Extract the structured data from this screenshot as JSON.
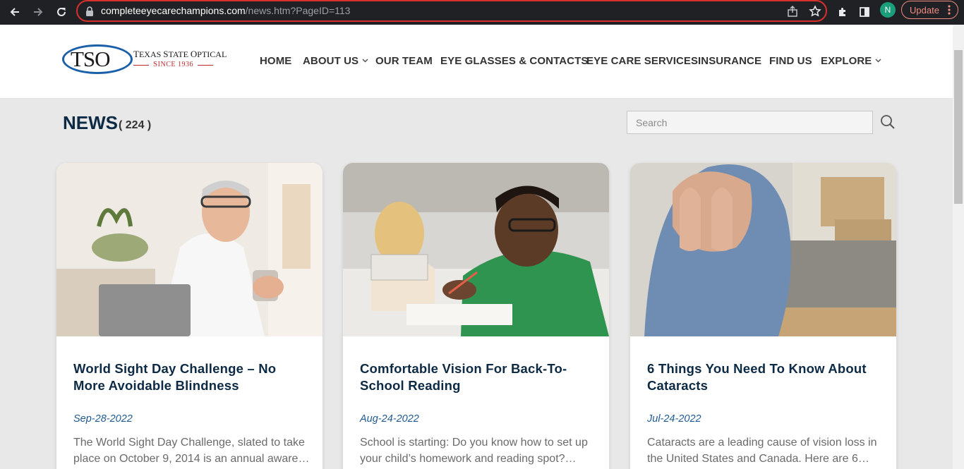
{
  "browser": {
    "url_host": "completeeyecarechampions.com",
    "url_path": "/news.htm?PageID=113",
    "profile_initial": "N",
    "update_label": "Update"
  },
  "logo": {
    "mark": "TSO",
    "name": "Texas State Optical",
    "since": "Since 1936"
  },
  "nav": {
    "items": [
      {
        "label": "HOME"
      },
      {
        "label": "ABOUT US"
      },
      {
        "label": "OUR TEAM"
      },
      {
        "label": "EYE GLASSES & CONTACTS"
      },
      {
        "label": "EYE CARE SERVICES"
      },
      {
        "label": "INSURANCE"
      },
      {
        "label": "FIND US"
      },
      {
        "label": "EXPLORE"
      }
    ]
  },
  "news": {
    "heading": "NEWS",
    "count": "( 224 )",
    "search_placeholder": "Search"
  },
  "articles": [
    {
      "title": "World Sight Day Challenge – No More Avoidable Blindness",
      "date": "Sep-28-2022",
      "excerpt": "The World Sight Day Challenge, slated to take place on October 9, 2014 is an annual aware…"
    },
    {
      "title": "Comfortable Vision For Back-To-School Reading",
      "date": "Aug-24-2022",
      "excerpt": "School is starting: Do you know how to set up your child’s homework and reading spot?…"
    },
    {
      "title": "6 Things You Need To Know About Cataracts",
      "date": "Jul-24-2022",
      "excerpt": "Cataracts are a leading cause of vision loss in the United States and Canada. Here are 6…"
    }
  ]
}
